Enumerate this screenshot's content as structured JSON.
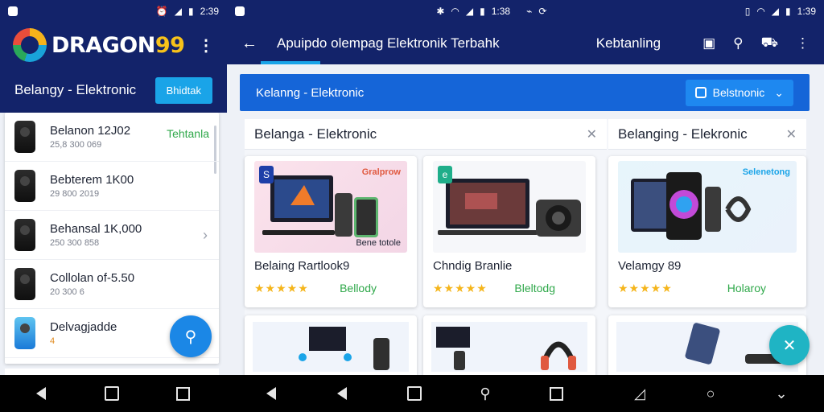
{
  "left": {
    "status": {
      "time": "2:39"
    },
    "brand": {
      "name": "DRAGON",
      "number": "99"
    },
    "subheader": {
      "title": "Belangy - Elektronic",
      "button": "Bhidtak"
    },
    "items": [
      {
        "name": "Belanon 12J02",
        "sub": "25,8 300 069",
        "tag": "Tehtanla"
      },
      {
        "name": "Bebterem 1K00",
        "sub": "29 800 2019",
        "tag": ""
      },
      {
        "name": "Behansal 1K,000",
        "sub": "250 300 858",
        "tag": ""
      },
      {
        "name": "Collolan of-5.50",
        "sub": "20 300 6",
        "tag": ""
      },
      {
        "name": "Delvagjadde",
        "sub": "4",
        "tag": ""
      }
    ]
  },
  "right": {
    "status": {
      "time": "1:38"
    },
    "status2": {
      "time": "1:39"
    },
    "header": {
      "title": "Apuipdo olempag Elektronik Terbahk",
      "action": "Kebtanling"
    },
    "banner": {
      "title": "Kelanng - Elektronic",
      "select": "Belstnonic"
    },
    "searchbars": [
      {
        "text": "Belanga - Elektronic"
      },
      {
        "text": "Belanging - Elekronic"
      }
    ],
    "products": [
      {
        "name": "Belaing Rartlook9",
        "label": "Bellody",
        "promo": "Gralprow",
        "caption": "Bene totole",
        "badge": "S"
      },
      {
        "name": "Chndig Branlie",
        "label": "Bleltodg",
        "promo": "",
        "caption": "",
        "badge": "e"
      },
      {
        "name": "Velamgy 89",
        "label": "Holaroy",
        "promo": "Selenetong",
        "caption": "",
        "badge": ""
      }
    ],
    "stars": "★★★★★"
  }
}
